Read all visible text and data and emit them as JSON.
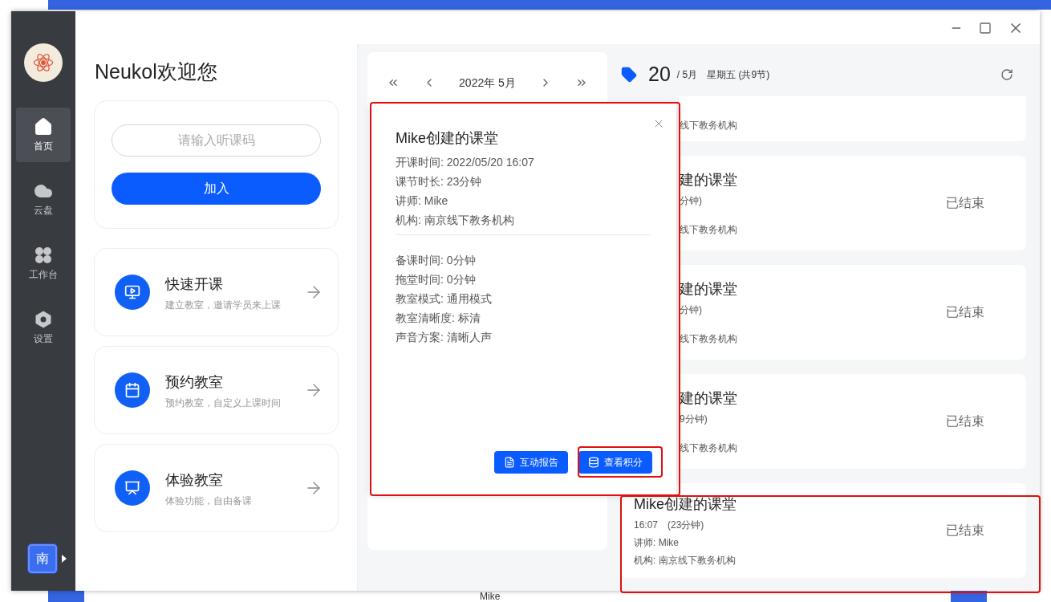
{
  "background": {
    "text": "Mike"
  },
  "sidebar": {
    "items": [
      {
        "label": "首页",
        "kind": "home",
        "selected": true
      },
      {
        "label": "云盘",
        "kind": "cloud",
        "selected": false
      },
      {
        "label": "工作台",
        "kind": "apps",
        "selected": false
      },
      {
        "label": "设置",
        "kind": "settings",
        "selected": false
      }
    ],
    "org_badge": "南"
  },
  "home": {
    "title": "Neukol欢迎您",
    "join": {
      "placeholder": "请输入听课码",
      "button": "加入"
    },
    "features": [
      {
        "kind": "start",
        "title": "快速开课",
        "subtitle": "建立教室，邀请学员来上课"
      },
      {
        "kind": "schedule",
        "title": "预约教室",
        "subtitle": "预约教室，自定义上课时间"
      },
      {
        "kind": "trial",
        "title": "体验教室",
        "subtitle": "体验功能，自由备课"
      }
    ]
  },
  "calendar": {
    "month": "2022年 5月"
  },
  "day": {
    "date": "20",
    "month": "/ 5月",
    "weekday": "星期五 (共9节)"
  },
  "lessons": [
    {
      "kind": "partial",
      "org": "线下教务机构"
    },
    {
      "kind": "partial",
      "title": "建的课堂",
      "time": "分钟)",
      "org": "线下教务机构",
      "status": "已结束"
    },
    {
      "kind": "partial",
      "title": "建的课堂",
      "time": "分钟)",
      "org": "线下教务机构",
      "status": "已结束"
    },
    {
      "kind": "partial",
      "title": "建的课堂",
      "time": "9分钟)",
      "org": "线下教务机构",
      "status": "已结束"
    },
    {
      "kind": "full",
      "title": "Mike创建的课堂",
      "time": "16:07　(23分钟)",
      "teacher": "讲师: Mike",
      "org": "机构: 南京线下教务机构",
      "status": "已结束"
    }
  ],
  "popup": {
    "title": "Mike创建的课堂",
    "info": [
      "开课时间: 2022/05/20 16:07",
      "课节时长: 23分钟",
      "讲师: Mike",
      "机构: 南京线下教务机构"
    ],
    "details": [
      "备课时间: 0分钟",
      "拖堂时间: 0分钟",
      "教室模式: 通用模式",
      "教室清晰度: 标清",
      "声音方案: 清晰人声"
    ],
    "buttons": [
      {
        "kind": "report",
        "label": "互动报告"
      },
      {
        "kind": "points",
        "label": "查看积分"
      }
    ]
  }
}
